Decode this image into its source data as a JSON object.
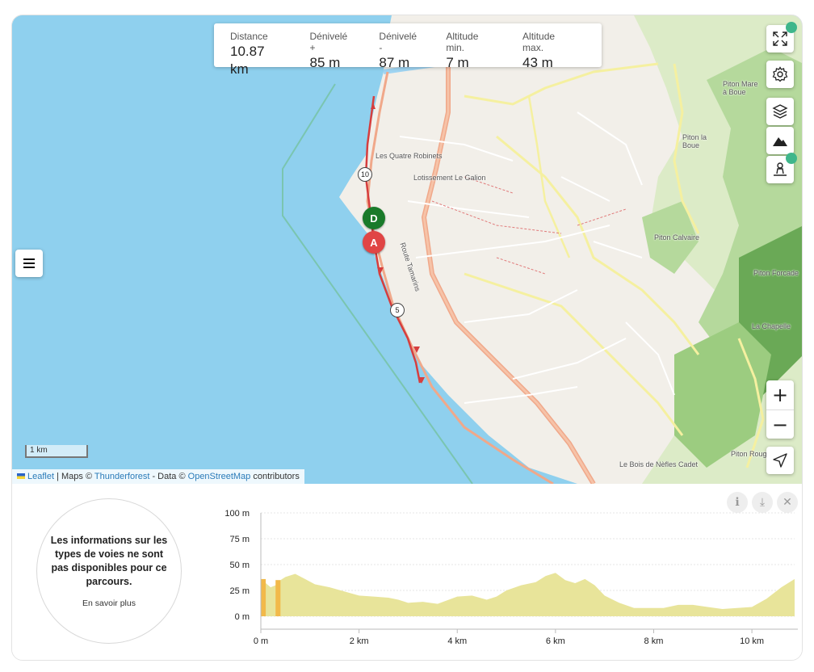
{
  "stats": [
    {
      "label": "Distance",
      "value": "10.87 km"
    },
    {
      "label": "Dénivelé +",
      "value": "85 m"
    },
    {
      "label": "Dénivelé -",
      "value": "87 m"
    },
    {
      "label": "Altitude min.",
      "value": "7 m"
    },
    {
      "label": "Altitude max.",
      "value": "43 m"
    }
  ],
  "map": {
    "places": [
      {
        "name": "Les Quatre Robinets"
      },
      {
        "name": "Lotissement Le Galion"
      },
      {
        "name": "Piton Mare à Boue"
      },
      {
        "name": "Piton la Boue"
      },
      {
        "name": "Piton Calvaire"
      },
      {
        "name": "Piton Forcade"
      },
      {
        "name": "La Chapelle"
      },
      {
        "name": "Le Bois de Nèfles Cadet"
      },
      {
        "name": "Piton Rouge"
      },
      {
        "name": "Route Tamarins"
      }
    ],
    "markers": {
      "start": "D",
      "end": "A"
    },
    "km_markers": [
      "10",
      "5"
    ],
    "route_color": "#d63e3e",
    "start_color": "#1a7a2a",
    "end_color": "#e04545"
  },
  "scale_label": "1 km",
  "attribution": {
    "leaflet": "Leaflet",
    "sep": " | Maps © ",
    "thunderforest": "Thunderforest",
    "data": " - Data © ",
    "osm": "OpenStreetMap",
    "contributors": " contributors"
  },
  "controls": [
    "fullscreen-icon",
    "settings-icon",
    "layers-icon",
    "terrain-icon",
    "streetview-icon"
  ],
  "zoom": {
    "in": "+",
    "out": "−"
  },
  "surface_info": {
    "message": "Les informations sur les types de voies ne sont pas disponibles pour ce parcours.",
    "link": "En savoir plus"
  },
  "chart_data": {
    "type": "area",
    "title": "",
    "xlabel": "",
    "ylabel": "",
    "x_ticks": [
      "0 m",
      "2 km",
      "4 km",
      "6 km",
      "8 km",
      "10 km"
    ],
    "y_ticks": [
      "100 m",
      "75 m",
      "50 m",
      "25 m",
      "0 m"
    ],
    "xlim": [
      0,
      10.87
    ],
    "ylim": [
      0,
      100
    ],
    "fill_color": "#e8e49a",
    "highlight_color": "#f2b94a",
    "x": [
      0,
      0.1,
      0.2,
      0.3,
      0.4,
      0.5,
      0.7,
      0.9,
      1.1,
      1.4,
      1.7,
      2.0,
      2.3,
      2.6,
      2.8,
      3.0,
      3.3,
      3.6,
      4.0,
      4.3,
      4.6,
      4.8,
      5.0,
      5.3,
      5.6,
      5.8,
      6.0,
      6.2,
      6.4,
      6.6,
      6.8,
      7.0,
      7.3,
      7.6,
      7.9,
      8.2,
      8.5,
      8.8,
      9.1,
      9.4,
      9.7,
      10.0,
      10.3,
      10.6,
      10.87
    ],
    "y": [
      36,
      32,
      28,
      30,
      35,
      38,
      41,
      36,
      31,
      28,
      24,
      20,
      19,
      18,
      16,
      13,
      14,
      12,
      19,
      20,
      16,
      19,
      25,
      30,
      33,
      39,
      42,
      35,
      32,
      36,
      30,
      20,
      13,
      8,
      8,
      8,
      11,
      11,
      9,
      7,
      8,
      9,
      17,
      28,
      36
    ],
    "highlights": [
      [
        0,
        0.1
      ],
      [
        0.3,
        0.4
      ]
    ]
  },
  "chart_buttons": [
    "info-icon",
    "download-icon",
    "close-icon"
  ]
}
